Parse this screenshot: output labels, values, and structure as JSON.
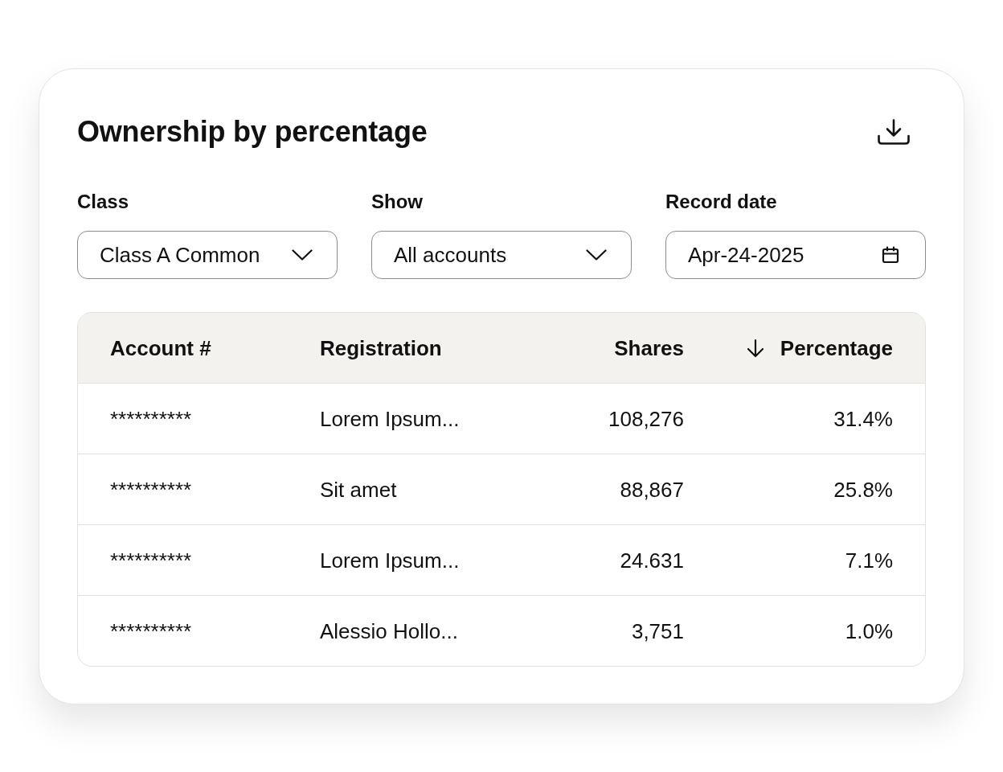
{
  "card": {
    "title": "Ownership by percentage"
  },
  "filters": [
    {
      "label": "Class",
      "kind": "select",
      "value": "Class A Common"
    },
    {
      "label": "Show",
      "kind": "select",
      "value": "All accounts"
    },
    {
      "label": "Record date",
      "kind": "date",
      "value": "Apr-24-2025"
    }
  ],
  "table": {
    "columns": [
      {
        "label": "Account #",
        "kind": "text",
        "sorted": false
      },
      {
        "label": "Registration",
        "kind": "text",
        "sorted": false
      },
      {
        "label": "Shares",
        "kind": "number",
        "sorted": false
      },
      {
        "label": "Percentage",
        "kind": "number",
        "sorted": true
      }
    ],
    "rows": [
      [
        "**********",
        "Lorem Ipsum...",
        "108,276",
        "31.4%"
      ],
      [
        "**********",
        "Sit amet",
        "88,867",
        "25.8%"
      ],
      [
        "**********",
        "Lorem Ipsum...",
        "24.631",
        "7.1%"
      ],
      [
        "**********",
        "Alessio Hollo...",
        "3,751",
        "1.0%"
      ]
    ]
  }
}
